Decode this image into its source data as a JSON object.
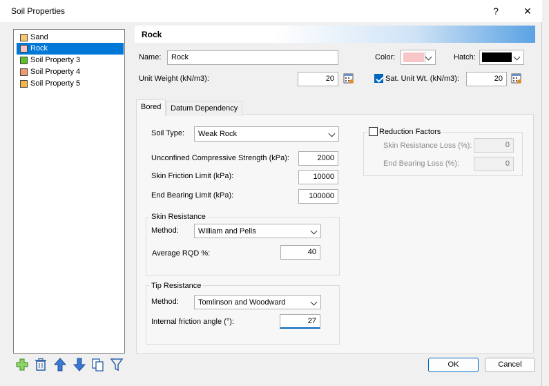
{
  "window": {
    "title": "Soil Properties",
    "help_label": "?",
    "close_label": "✕"
  },
  "soil_list": {
    "items": [
      {
        "label": "Sand",
        "color": "#f5c76a"
      },
      {
        "label": "Rock",
        "color": "#f7c6c6",
        "selected": true
      },
      {
        "label": "Soil Property 3",
        "color": "#5bbf2a"
      },
      {
        "label": "Soil Property 4",
        "color": "#f29a6e"
      },
      {
        "label": "Soil Property 5",
        "color": "#f7b447"
      }
    ]
  },
  "header": {
    "title": "Rock"
  },
  "props": {
    "name_label": "Name:",
    "name_value": "Rock",
    "color_label": "Color:",
    "color_value": "#f7c6c6",
    "hatch_label": "Hatch:",
    "hatch_value": "#000000",
    "unit_weight_label": "Unit Weight (kN/m3):",
    "unit_weight_value": "20",
    "sat_unit_wt_label": "Sat. Unit Wt. (kN/m3):",
    "sat_unit_wt_checked": true,
    "sat_unit_wt_value": "20"
  },
  "tabs": [
    {
      "label": "Bored",
      "active": true
    },
    {
      "label": "Datum Dependency",
      "active": false
    }
  ],
  "bored": {
    "soil_type_label": "Soil Type:",
    "soil_type_value": "Weak Rock",
    "ucs_label": "Unconfined Compressive Strength (kPa):",
    "ucs_value": "2000",
    "skin_friction_label": "Skin Friction Limit (kPa):",
    "skin_friction_value": "10000",
    "end_bearing_label": "End Bearing Limit (kPa):",
    "end_bearing_value": "100000",
    "skin_resistance": {
      "group_label": "Skin Resistance",
      "method_label": "Method:",
      "method_value": "William and Pells",
      "rqd_label": "Average RQD %:",
      "rqd_value": "40"
    },
    "tip_resistance": {
      "group_label": "Tip Resistance",
      "method_label": "Method:",
      "method_value": "Tomlinson and Woodward",
      "friction_angle_label": "Internal friction angle (°):",
      "friction_angle_value": "27"
    },
    "reduction": {
      "label": "Reduction Factors",
      "checked": false,
      "skin_loss_label": "Skin Resistance Loss (%):",
      "skin_loss_value": "0",
      "end_loss_label": "End Bearing Loss (%):",
      "end_loss_value": "0"
    }
  },
  "toolbar": {
    "icons": [
      "add-icon",
      "delete-icon",
      "move-up-icon",
      "move-down-icon",
      "copy-icon",
      "filter-icon"
    ]
  },
  "buttons": {
    "ok": "OK",
    "cancel": "Cancel"
  }
}
